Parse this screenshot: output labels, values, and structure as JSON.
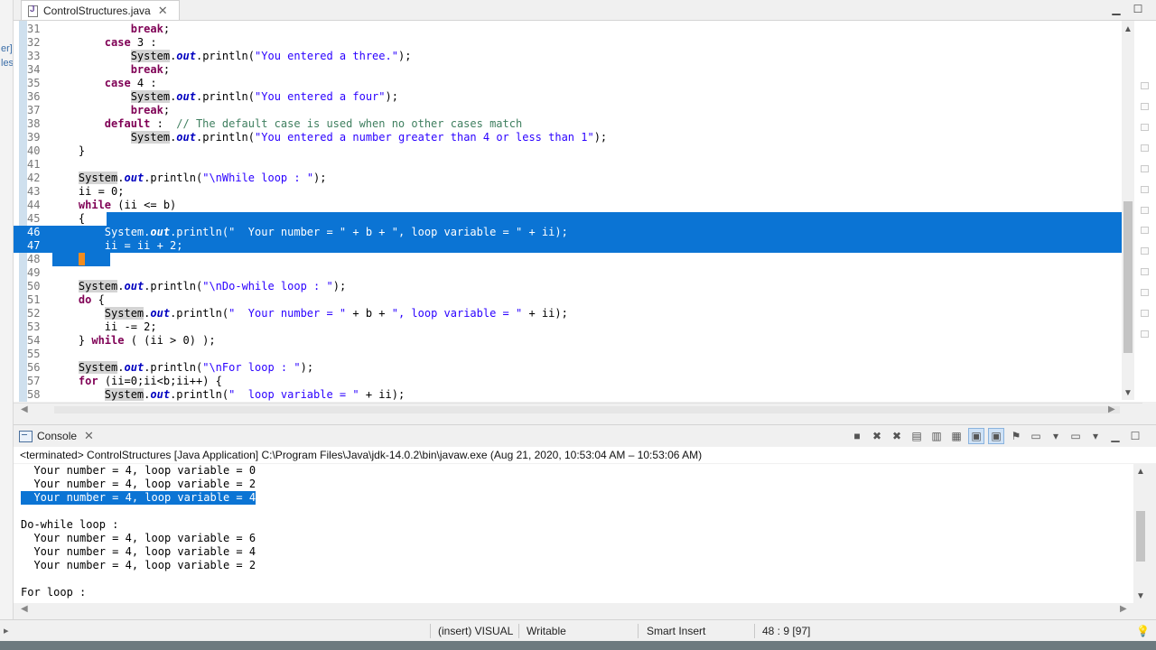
{
  "editor": {
    "tab_title": "ControlStructures.java",
    "lines": [
      {
        "n": "31",
        "tokens": [
          {
            "t": "            "
          },
          {
            "t": "break",
            "c": "kw"
          },
          {
            "t": ";"
          }
        ]
      },
      {
        "n": "32",
        "tokens": [
          {
            "t": "        "
          },
          {
            "t": "case",
            "c": "kw"
          },
          {
            "t": " 3 :"
          }
        ]
      },
      {
        "n": "33",
        "tokens": [
          {
            "t": "            "
          },
          {
            "t": "System",
            "c": "sys"
          },
          {
            "t": "."
          },
          {
            "t": "out",
            "c": "fld"
          },
          {
            "t": ".println("
          },
          {
            "t": "\"You entered a three.\"",
            "c": "str"
          },
          {
            "t": ");"
          }
        ]
      },
      {
        "n": "34",
        "tokens": [
          {
            "t": "            "
          },
          {
            "t": "break",
            "c": "kw"
          },
          {
            "t": ";"
          }
        ]
      },
      {
        "n": "35",
        "tokens": [
          {
            "t": "        "
          },
          {
            "t": "case",
            "c": "kw"
          },
          {
            "t": " 4 :"
          }
        ]
      },
      {
        "n": "36",
        "tokens": [
          {
            "t": "            "
          },
          {
            "t": "System",
            "c": "sys"
          },
          {
            "t": "."
          },
          {
            "t": "out",
            "c": "fld"
          },
          {
            "t": ".println("
          },
          {
            "t": "\"You entered a four\"",
            "c": "str"
          },
          {
            "t": ");"
          }
        ]
      },
      {
        "n": "37",
        "tokens": [
          {
            "t": "            "
          },
          {
            "t": "break",
            "c": "kw"
          },
          {
            "t": ";"
          }
        ]
      },
      {
        "n": "38",
        "tokens": [
          {
            "t": "        "
          },
          {
            "t": "default",
            "c": "kw"
          },
          {
            "t": " :  "
          },
          {
            "t": "// The default case is used when no other cases match",
            "c": "com"
          }
        ]
      },
      {
        "n": "39",
        "tokens": [
          {
            "t": "            "
          },
          {
            "t": "System",
            "c": "sys"
          },
          {
            "t": "."
          },
          {
            "t": "out",
            "c": "fld"
          },
          {
            "t": ".println("
          },
          {
            "t": "\"You entered a number greater than 4 or less than 1\"",
            "c": "str"
          },
          {
            "t": ");"
          }
        ]
      },
      {
        "n": "40",
        "tokens": [
          {
            "t": "    }"
          }
        ]
      },
      {
        "n": "41",
        "tokens": []
      },
      {
        "n": "42",
        "tokens": [
          {
            "t": "    "
          },
          {
            "t": "System",
            "c": "sys"
          },
          {
            "t": "."
          },
          {
            "t": "out",
            "c": "fld"
          },
          {
            "t": ".println("
          },
          {
            "t": "\"\\nWhile loop : \"",
            "c": "str"
          },
          {
            "t": ");"
          }
        ]
      },
      {
        "n": "43",
        "tokens": [
          {
            "t": "    ii = 0;"
          }
        ]
      },
      {
        "n": "44",
        "tokens": [
          {
            "t": "    "
          },
          {
            "t": "while",
            "c": "kw"
          },
          {
            "t": " (ii <= b)"
          }
        ]
      },
      {
        "n": "45",
        "sel": "partial",
        "tokens": [
          {
            "t": "    {"
          }
        ]
      },
      {
        "n": "46",
        "sel": "full",
        "tokens": [
          {
            "t": "        System."
          },
          {
            "t": "out",
            "c": "fld"
          },
          {
            "t": ".println("
          },
          {
            "t": "\"  Your number = \"",
            "c": "str"
          },
          {
            "t": " + b + "
          },
          {
            "t": "\", loop variable = \"",
            "c": "str"
          },
          {
            "t": " + ii);"
          }
        ]
      },
      {
        "n": "47",
        "sel": "full",
        "tokens": [
          {
            "t": "        ii = ii + 2;"
          }
        ]
      },
      {
        "n": "48",
        "sel": "partial-end",
        "tokens": [
          {
            "t": "    }"
          }
        ]
      },
      {
        "n": "49",
        "tokens": []
      },
      {
        "n": "50",
        "tokens": [
          {
            "t": "    "
          },
          {
            "t": "System",
            "c": "sys"
          },
          {
            "t": "."
          },
          {
            "t": "out",
            "c": "fld"
          },
          {
            "t": ".println("
          },
          {
            "t": "\"\\nDo-while loop : \"",
            "c": "str"
          },
          {
            "t": ");"
          }
        ]
      },
      {
        "n": "51",
        "tokens": [
          {
            "t": "    "
          },
          {
            "t": "do",
            "c": "kw"
          },
          {
            "t": " {"
          }
        ]
      },
      {
        "n": "52",
        "tokens": [
          {
            "t": "        "
          },
          {
            "t": "System",
            "c": "sys"
          },
          {
            "t": "."
          },
          {
            "t": "out",
            "c": "fld"
          },
          {
            "t": ".println("
          },
          {
            "t": "\"  Your number = \"",
            "c": "str"
          },
          {
            "t": " + b + "
          },
          {
            "t": "\", loop variable = \"",
            "c": "str"
          },
          {
            "t": " + ii);"
          }
        ]
      },
      {
        "n": "53",
        "tokens": [
          {
            "t": "        ii -= 2;"
          }
        ]
      },
      {
        "n": "54",
        "tokens": [
          {
            "t": "    } "
          },
          {
            "t": "while",
            "c": "kw"
          },
          {
            "t": " ( (ii > 0) );"
          }
        ]
      },
      {
        "n": "55",
        "tokens": []
      },
      {
        "n": "56",
        "tokens": [
          {
            "t": "    "
          },
          {
            "t": "System",
            "c": "sys"
          },
          {
            "t": "."
          },
          {
            "t": "out",
            "c": "fld"
          },
          {
            "t": ".println("
          },
          {
            "t": "\"\\nFor loop : \"",
            "c": "str"
          },
          {
            "t": ");"
          }
        ]
      },
      {
        "n": "57",
        "tokens": [
          {
            "t": "    "
          },
          {
            "t": "for",
            "c": "kw"
          },
          {
            "t": " (ii=0;ii<b;ii++) {"
          }
        ]
      },
      {
        "n": "58",
        "tokens": [
          {
            "t": "        "
          },
          {
            "t": "System",
            "c": "sys"
          },
          {
            "t": "."
          },
          {
            "t": "out",
            "c": "fld"
          },
          {
            "t": ".println("
          },
          {
            "t": "\"  loop variable = \"",
            "c": "str"
          },
          {
            "t": " + ii);"
          }
        ]
      }
    ]
  },
  "console": {
    "tab_title": "Console",
    "header": "<terminated> ControlStructures [Java Application] C:\\Program Files\\Java\\jdk-14.0.2\\bin\\javaw.exe  (Aug 21, 2020, 10:53:04 AM – 10:53:06 AM)",
    "lines": [
      {
        "t": "  Your number = 4, loop variable = 0"
      },
      {
        "t": "  Your number = 4, loop variable = 2"
      },
      {
        "t": "  Your number = 4, loop variable = 4",
        "sel": true
      },
      {
        "t": ""
      },
      {
        "t": "Do-while loop :"
      },
      {
        "t": "  Your number = 4, loop variable = 6"
      },
      {
        "t": "  Your number = 4, loop variable = 4"
      },
      {
        "t": "  Your number = 4, loop variable = 2"
      },
      {
        "t": ""
      },
      {
        "t": "For loop :"
      }
    ]
  },
  "left_strip": {
    "frag1": "er]",
    "frag2": "les"
  },
  "status": {
    "mode": "(insert) VISUAL",
    "writable": "Writable",
    "insert_mode": "Smart Insert",
    "position": "48 : 9 [97]"
  },
  "colors": {
    "selection": "#0b74d4",
    "keyword": "#7f0055",
    "string": "#2a00ff",
    "comment": "#3f7f5f",
    "cursor_marker": "#f28c1e"
  }
}
